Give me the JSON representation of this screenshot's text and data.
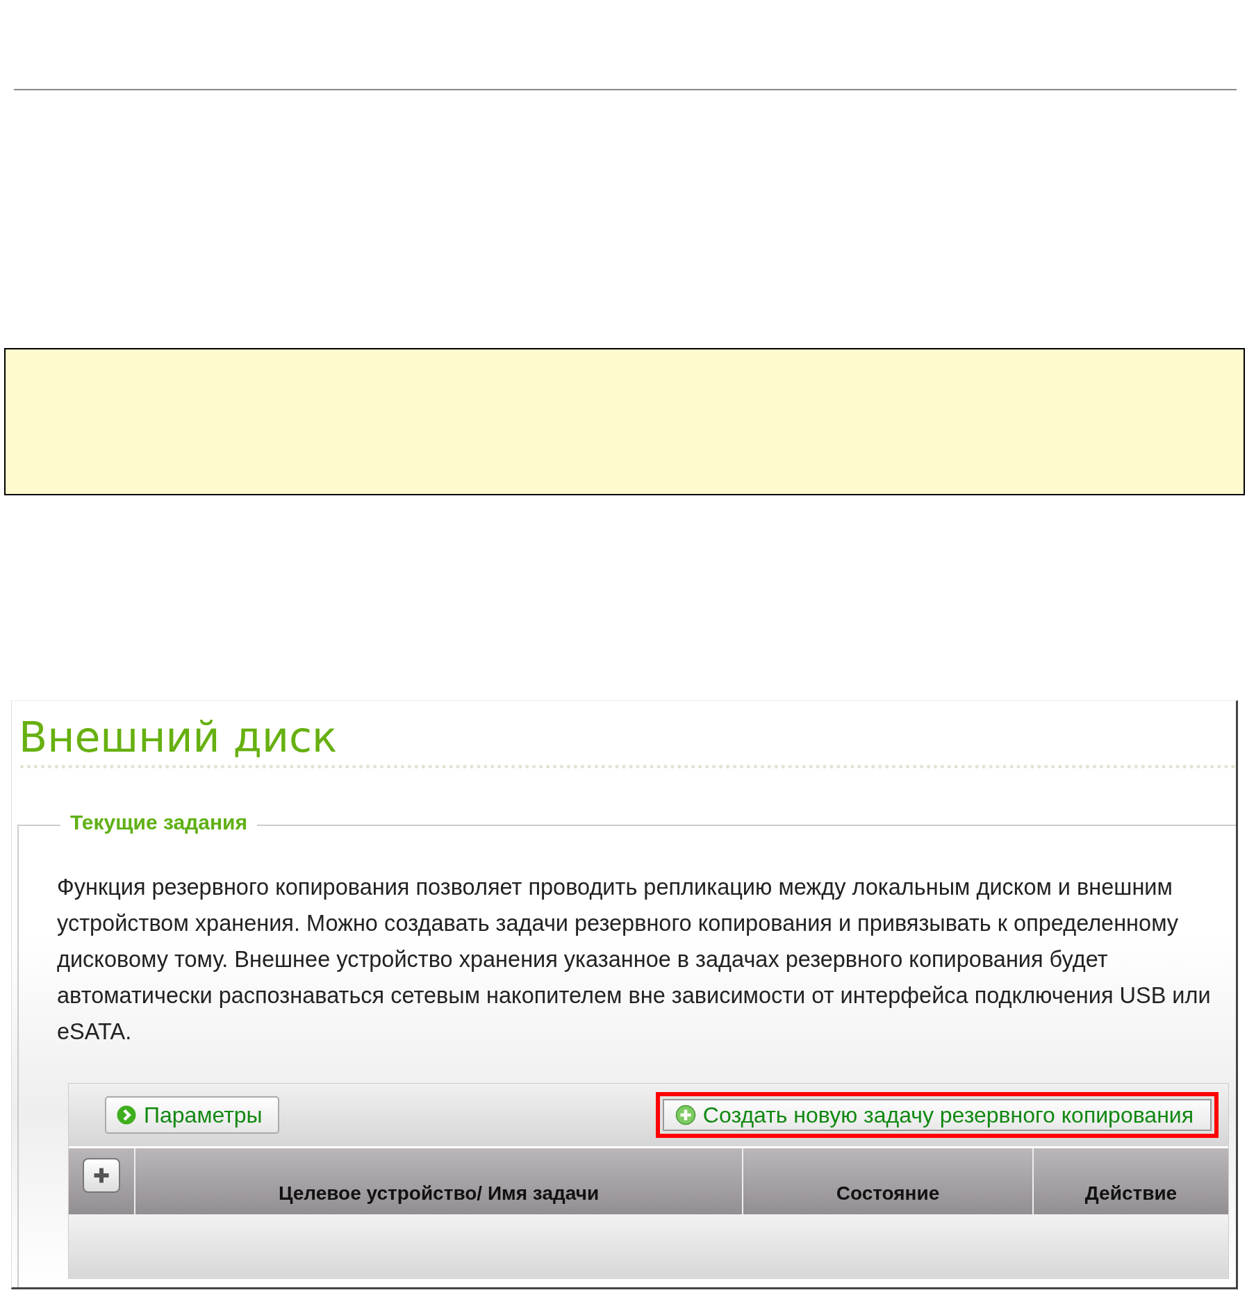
{
  "page_title": "Внешний диск",
  "section": {
    "legend": "Текущие задания",
    "description": "Функция резервного копирования позволяет проводить репликацию между локальным диском и внешним устройством хранения. Можно создавать задачи резервного копирования и привязывать к определенному дисковому тому. Внешнее устройство хранения указанное в задачах резервного копирования будет автоматически распознаваться сетевым накопителем вне зависимости от интерфейса подключения USB или eSATA."
  },
  "toolbar": [
    {
      "label": "Параметры",
      "kind": "settings",
      "highlighted": false
    },
    {
      "label": "Создать новую задачу резервного копирования",
      "kind": "create",
      "highlighted": true
    }
  ],
  "table": {
    "columns": [
      "Целевое устройство/ Имя задачи",
      "Состояние",
      "Действие"
    ]
  }
}
